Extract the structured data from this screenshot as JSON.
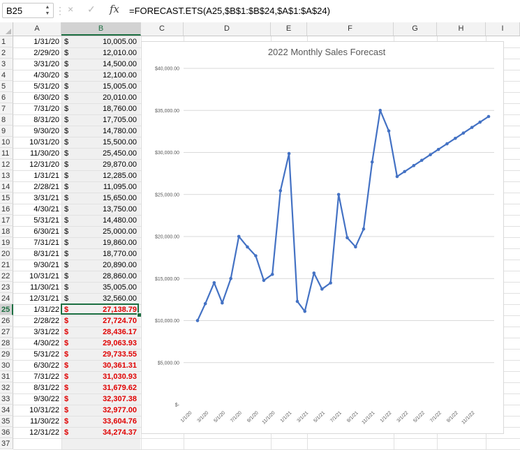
{
  "formula_bar": {
    "name_box": "B25",
    "cancel_icon": "×",
    "enter_icon": "✓",
    "fx_label": "fx",
    "formula": "=FORECAST.ETS(A25,$B$1:$B$24,$A$1:$A$24)"
  },
  "columns": [
    "A",
    "B",
    "C",
    "D",
    "E",
    "F",
    "G",
    "H",
    "I"
  ],
  "rows": [
    "1",
    "2",
    "3",
    "4",
    "5",
    "6",
    "7",
    "8",
    "9",
    "10",
    "11",
    "12",
    "13",
    "14",
    "15",
    "16",
    "17",
    "18",
    "19",
    "20",
    "21",
    "22",
    "23",
    "24",
    "25",
    "26",
    "27",
    "28",
    "29",
    "30",
    "31",
    "32",
    "33",
    "34",
    "35",
    "36",
    "37"
  ],
  "selected": {
    "column": "B",
    "row": "25"
  },
  "table": [
    {
      "date": "1/31/20",
      "dollar": "$",
      "value": "10,005.00",
      "forecast": false
    },
    {
      "date": "2/29/20",
      "dollar": "$",
      "value": "12,010.00",
      "forecast": false
    },
    {
      "date": "3/31/20",
      "dollar": "$",
      "value": "14,500.00",
      "forecast": false
    },
    {
      "date": "4/30/20",
      "dollar": "$",
      "value": "12,100.00",
      "forecast": false
    },
    {
      "date": "5/31/20",
      "dollar": "$",
      "value": "15,005.00",
      "forecast": false
    },
    {
      "date": "6/30/20",
      "dollar": "$",
      "value": "20,010.00",
      "forecast": false
    },
    {
      "date": "7/31/20",
      "dollar": "$",
      "value": "18,760.00",
      "forecast": false
    },
    {
      "date": "8/31/20",
      "dollar": "$",
      "value": "17,705.00",
      "forecast": false
    },
    {
      "date": "9/30/20",
      "dollar": "$",
      "value": "14,780.00",
      "forecast": false
    },
    {
      "date": "10/31/20",
      "dollar": "$",
      "value": "15,500.00",
      "forecast": false
    },
    {
      "date": "11/30/20",
      "dollar": "$",
      "value": "25,450.00",
      "forecast": false
    },
    {
      "date": "12/31/20",
      "dollar": "$",
      "value": "29,870.00",
      "forecast": false
    },
    {
      "date": "1/31/21",
      "dollar": "$",
      "value": "12,285.00",
      "forecast": false
    },
    {
      "date": "2/28/21",
      "dollar": "$",
      "value": "11,095.00",
      "forecast": false
    },
    {
      "date": "3/31/21",
      "dollar": "$",
      "value": "15,650.00",
      "forecast": false
    },
    {
      "date": "4/30/21",
      "dollar": "$",
      "value": "13,750.00",
      "forecast": false
    },
    {
      "date": "5/31/21",
      "dollar": "$",
      "value": "14,480.00",
      "forecast": false
    },
    {
      "date": "6/30/21",
      "dollar": "$",
      "value": "25,000.00",
      "forecast": false
    },
    {
      "date": "7/31/21",
      "dollar": "$",
      "value": "19,860.00",
      "forecast": false
    },
    {
      "date": "8/31/21",
      "dollar": "$",
      "value": "18,770.00",
      "forecast": false
    },
    {
      "date": "9/30/21",
      "dollar": "$",
      "value": "20,890.00",
      "forecast": false
    },
    {
      "date": "10/31/21",
      "dollar": "$",
      "value": "28,860.00",
      "forecast": false
    },
    {
      "date": "11/30/21",
      "dollar": "$",
      "value": "35,005.00",
      "forecast": false
    },
    {
      "date": "12/31/21",
      "dollar": "$",
      "value": "32,560.00",
      "forecast": false
    },
    {
      "date": "1/31/22",
      "dollar": "$",
      "value": "27,138.79",
      "forecast": true
    },
    {
      "date": "2/28/22",
      "dollar": "$",
      "value": "27,724.70",
      "forecast": true
    },
    {
      "date": "3/31/22",
      "dollar": "$",
      "value": "28,436.17",
      "forecast": true
    },
    {
      "date": "4/30/22",
      "dollar": "$",
      "value": "29,063.93",
      "forecast": true
    },
    {
      "date": "5/31/22",
      "dollar": "$",
      "value": "29,733.55",
      "forecast": true
    },
    {
      "date": "6/30/22",
      "dollar": "$",
      "value": "30,361.31",
      "forecast": true
    },
    {
      "date": "7/31/22",
      "dollar": "$",
      "value": "31,030.93",
      "forecast": true
    },
    {
      "date": "8/31/22",
      "dollar": "$",
      "value": "31,679.62",
      "forecast": true
    },
    {
      "date": "9/30/22",
      "dollar": "$",
      "value": "32,307.38",
      "forecast": true
    },
    {
      "date": "10/31/22",
      "dollar": "$",
      "value": "32,977.00",
      "forecast": true
    },
    {
      "date": "11/30/22",
      "dollar": "$",
      "value": "33,604.76",
      "forecast": true
    },
    {
      "date": "12/31/22",
      "dollar": "$",
      "value": "34,274.37",
      "forecast": true
    }
  ],
  "colors": {
    "forecast_text": "#e00000",
    "selection": "#1d6f42",
    "series": "#4472c4"
  },
  "chart_data": {
    "type": "line",
    "title": "2022 Monthly Sales Forecast",
    "ylim": [
      0,
      40000
    ],
    "y_ticks": [
      "$-",
      "$5,000.00",
      "$10,000.00",
      "$15,000.00",
      "$20,000.00",
      "$25,000.00",
      "$30,000.00",
      "$35,000.00",
      "$40,000.00"
    ],
    "x_tick_labels": [
      "1/1/20",
      "3/1/20",
      "5/1/20",
      "7/1/20",
      "9/1/20",
      "11/1/20",
      "1/1/21",
      "3/1/21",
      "5/1/21",
      "7/1/21",
      "9/1/21",
      "11/1/21",
      "1/1/22",
      "3/1/22",
      "5/1/22",
      "7/1/22",
      "9/1/22",
      "11/1/22"
    ],
    "grid": true,
    "legend": "none",
    "x": [
      "1/31/20",
      "2/29/20",
      "3/31/20",
      "4/30/20",
      "5/31/20",
      "6/30/20",
      "7/31/20",
      "8/31/20",
      "9/30/20",
      "10/31/20",
      "11/30/20",
      "12/31/20",
      "1/31/21",
      "2/28/21",
      "3/31/21",
      "4/30/21",
      "5/31/21",
      "6/30/21",
      "7/31/21",
      "8/31/21",
      "9/30/21",
      "10/31/21",
      "11/30/21",
      "12/31/21",
      "1/31/22",
      "2/28/22",
      "3/31/22",
      "4/30/22",
      "5/31/22",
      "6/30/22",
      "7/31/22",
      "8/31/22",
      "9/30/22",
      "10/31/22",
      "11/30/22",
      "12/31/22"
    ],
    "series": [
      {
        "values": [
          10005,
          12010,
          14500,
          12100,
          15005,
          20010,
          18760,
          17705,
          14780,
          15500,
          25450,
          29870,
          12285,
          11095,
          15650,
          13750,
          14480,
          25000,
          19860,
          18770,
          20890,
          28860,
          35005,
          32560,
          27138.79,
          27724.7,
          28436.17,
          29063.93,
          29733.55,
          30361.31,
          31030.93,
          31679.62,
          32307.38,
          32977.0,
          33604.76,
          34274.37
        ]
      }
    ]
  }
}
